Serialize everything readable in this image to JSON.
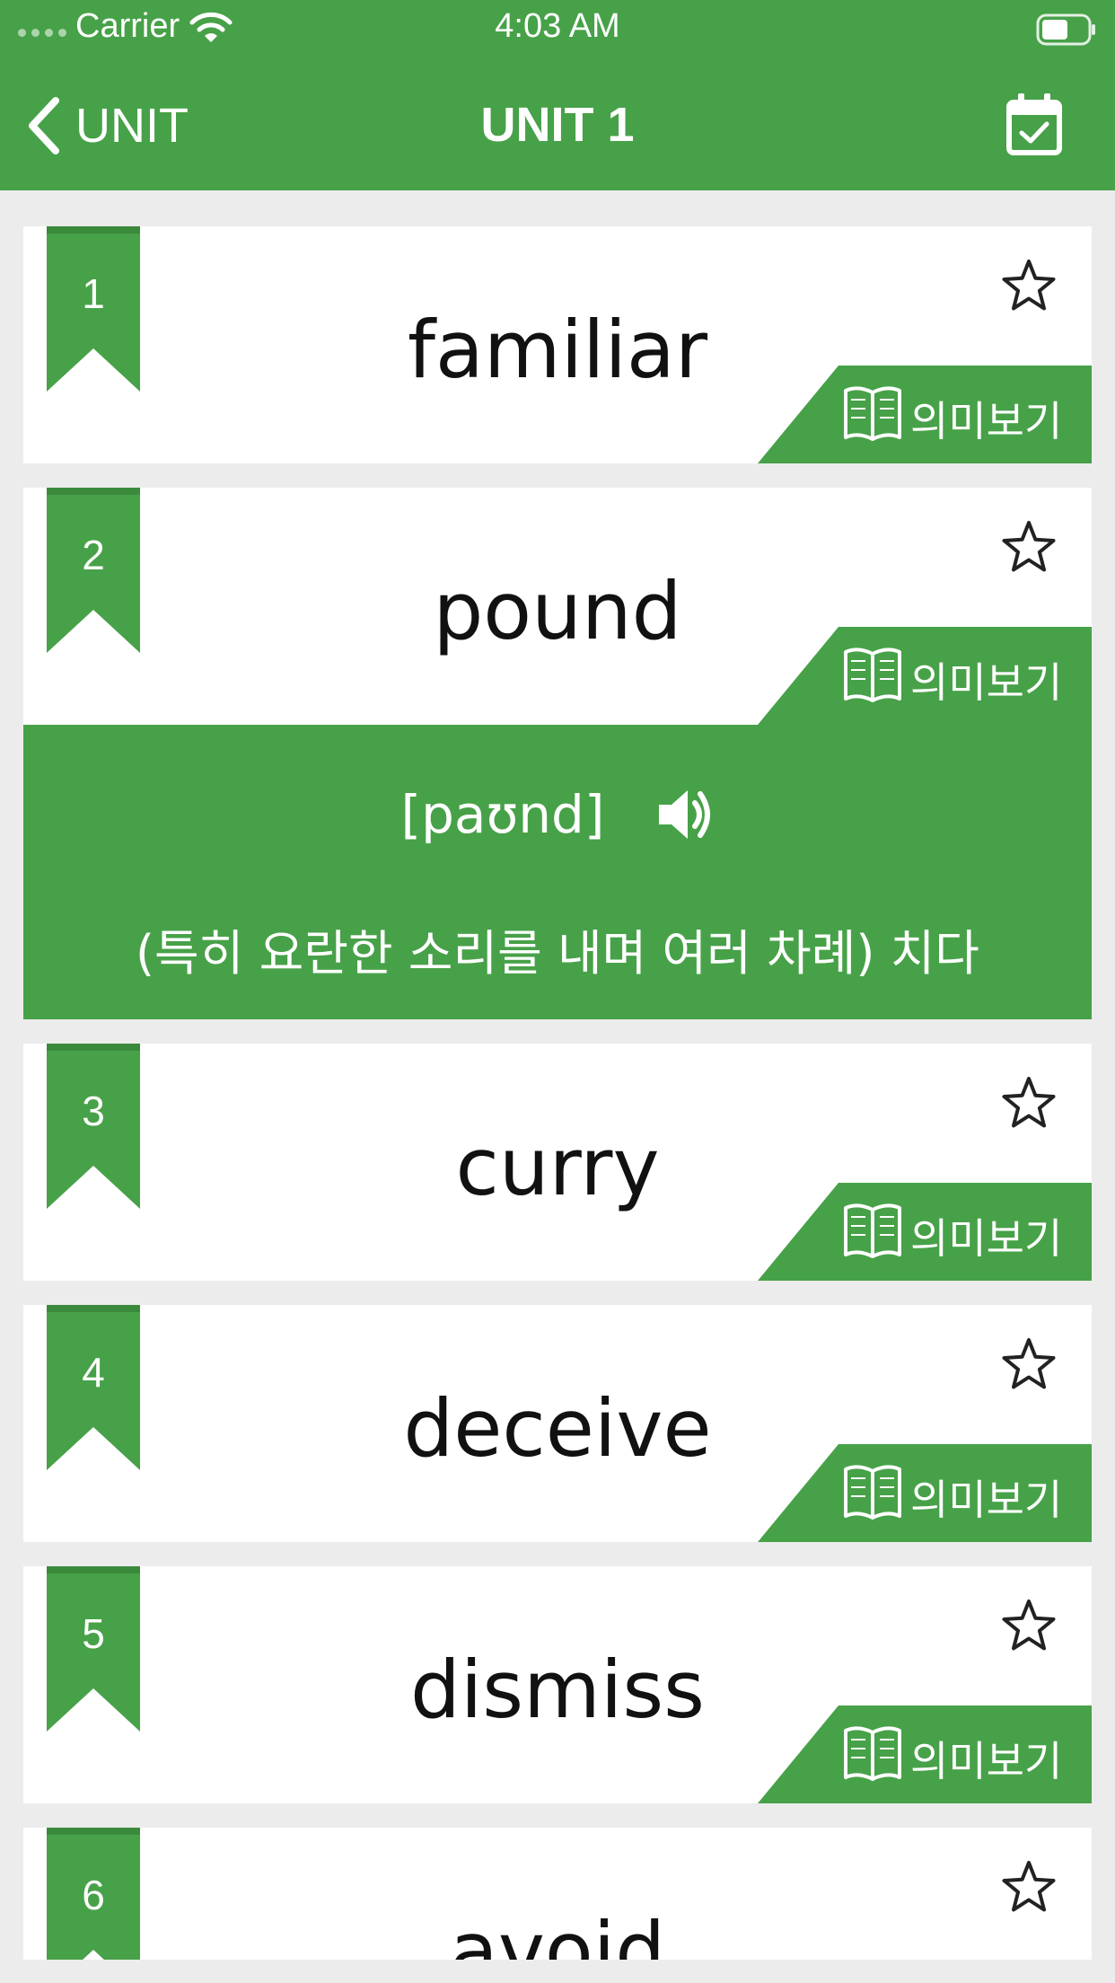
{
  "status_bar": {
    "carrier": "Carrier",
    "time": "4:03 AM"
  },
  "nav": {
    "back_label": "UNIT",
    "title": "UNIT 1"
  },
  "meaning_label": "의미보기",
  "colors": {
    "accent": "#47a148",
    "background": "#ececec",
    "card": "#ffffff"
  },
  "words": [
    {
      "number": "1",
      "word": "familiar",
      "starred": false,
      "expanded": false
    },
    {
      "number": "2",
      "word": "pound",
      "starred": false,
      "expanded": true,
      "pronunciation": "[paʊnd]",
      "definition": "(특히 요란한 소리를 내며 여러 차례) 치다"
    },
    {
      "number": "3",
      "word": "curry",
      "starred": false,
      "expanded": false
    },
    {
      "number": "4",
      "word": "deceive",
      "starred": false,
      "expanded": false
    },
    {
      "number": "5",
      "word": "dismiss",
      "starred": false,
      "expanded": false
    },
    {
      "number": "6",
      "word": "avoid",
      "starred": false,
      "expanded": false
    }
  ]
}
